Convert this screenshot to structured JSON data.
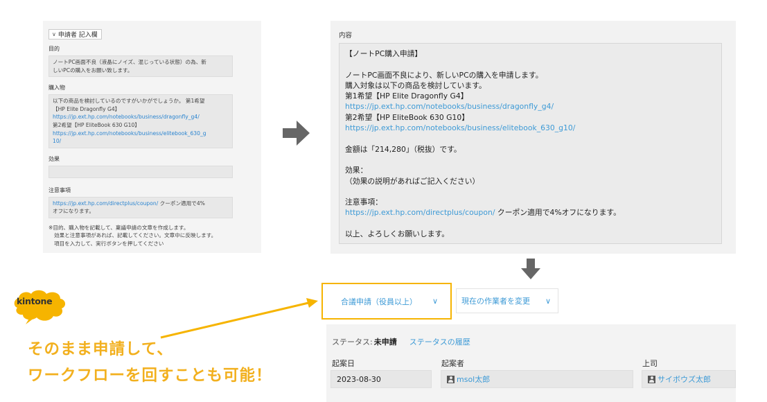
{
  "left_form": {
    "section_title": "申請者 記入欄",
    "purpose_label": "目的",
    "purpose_lines": [
      "ノートPC画面不良（液晶にノイズ、混じっている状態）の為、新",
      "しいPCの購入をお願い致します。"
    ],
    "purchase_label": "購入物",
    "purchase_line1": "以下の商品を検討しているのですがいかがでしょうか。 第1希望",
    "purchase_line2": "【HP Elite Dragonfly G4】",
    "purchase_link1": "https://jp.ext.hp.com/notebooks/business/dragonfly_g4/",
    "purchase_line3": "第2希望【HP EliteBook 630 G10】",
    "purchase_link2a": "https://jp.ext.hp.com/notebooks/business/elitebook_630_g",
    "purchase_link2b": "10/",
    "effect_label": "効果",
    "caution_label": "注意事項",
    "caution_link": "https://jp.ext.hp.com/directplus/coupon/",
    "caution_text1": " クーポン適用で4%",
    "caution_text2": "オフになります。",
    "note_lines": [
      "※目的、購入物を記載して、稟議申請の文章を作成します。",
      "効果と注意事項があれば、記載してください。文章中に反映します。",
      "項目を入力して、実行ボタンを押してください"
    ]
  },
  "content": {
    "label": "内容",
    "lines": [
      {
        "text": "【ノートPC購入申請】",
        "link": false
      },
      {
        "text": "",
        "link": false
      },
      {
        "text": "ノートPC画面不良により、新しいPCの購入を申請します。",
        "link": false
      },
      {
        "text": "購入対象は以下の商品を検討しています。",
        "link": false
      },
      {
        "text": "第1希望【HP Elite Dragonfly G4】",
        "link": false
      },
      {
        "text": "https://jp.ext.hp.com/notebooks/business/dragonfly_g4/",
        "link": true
      },
      {
        "text": "第2希望【HP EliteBook 630 G10】",
        "link": false
      },
      {
        "text": "https://jp.ext.hp.com/notebooks/business/elitebook_630_g10/",
        "link": true
      },
      {
        "text": "",
        "link": false
      },
      {
        "text": "金額は「214,280」（税抜）です。",
        "link": false
      },
      {
        "text": "",
        "link": false
      },
      {
        "text": "効果：",
        "link": false
      },
      {
        "text": "（効果の説明があればご記入ください）",
        "link": false
      },
      {
        "text": "",
        "link": false
      },
      {
        "text": "注意事項：",
        "link": false
      },
      {
        "text": "https://jp.ext.hp.com/directplus/coupon/",
        "link": true,
        "suffix": " クーポン適用で4%オフになります。"
      },
      {
        "text": "",
        "link": false
      },
      {
        "text": "以上、よろしくお願いします。",
        "link": false
      }
    ]
  },
  "actions": {
    "primary_label": "合議申請（役員以上）",
    "secondary_label": "現在の作業者を変更"
  },
  "status": {
    "status_label": "ステータス:",
    "status_value": "未申請",
    "history_link": "ステータスの履歴",
    "date_label": "起案日",
    "date_value": "2023-08-30",
    "drafter_label": "起案者",
    "drafter_value": "msol太郎",
    "boss_label": "上司",
    "boss_value": "サイボウズ太郎"
  },
  "annotation": {
    "logo_text": "kintone",
    "tagline_line1": "そのまま申請して、",
    "tagline_line2": "ワークフローを回すことも可能！"
  },
  "colors": {
    "accent_yellow": "#f6b400",
    "link_blue": "#3d9ad6",
    "arrow_gray": "#666666"
  }
}
